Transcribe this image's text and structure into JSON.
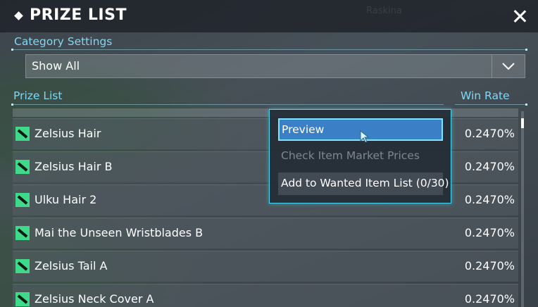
{
  "window": {
    "title": "PRIZE LIST",
    "watermark": "Raskina"
  },
  "category": {
    "label": "Category Settings",
    "selected": "Show All"
  },
  "list": {
    "header_name": "Prize List",
    "header_rate": "Win Rate",
    "items": [
      {
        "name": "Zelsius Hair",
        "rate": "0.2470%"
      },
      {
        "name": "Zelsius Hair B",
        "rate": "0.2470%"
      },
      {
        "name": "Ulku Hair 2",
        "rate": "0.2470%"
      },
      {
        "name": "Mai the Unseen Wristblades B",
        "rate": "0.2470%"
      },
      {
        "name": "Zelsius Tail A",
        "rate": "0.2470%"
      },
      {
        "name": "Zelsius Neck Cover A",
        "rate": "0.2470%"
      }
    ]
  },
  "context_menu": {
    "preview": "Preview",
    "market": "Check Item Market Prices",
    "wanted": "Add to Wanted Item List (0/30)"
  },
  "colors": {
    "accent": "#7fd8f5",
    "item_icon": "#3fd98a",
    "menu_border": "#4ad3ec",
    "menu_highlight": "#3b7fc6"
  }
}
